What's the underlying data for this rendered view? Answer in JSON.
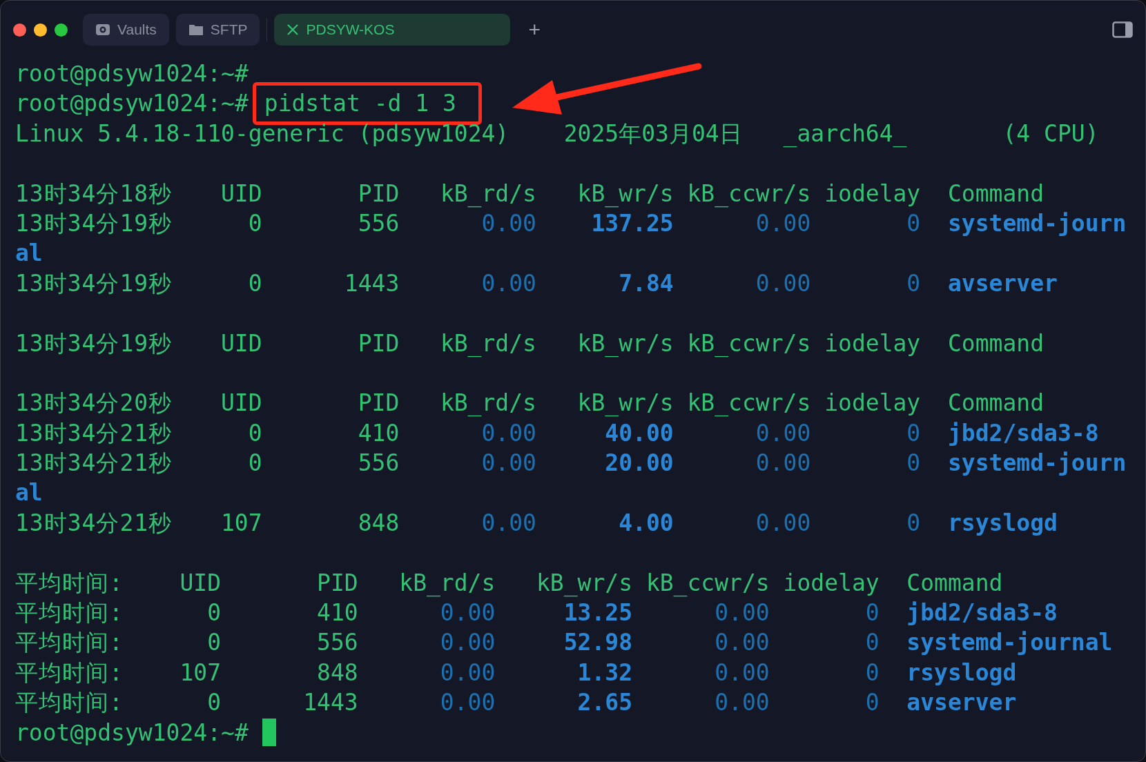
{
  "tabs": [
    {
      "label": "Vaults",
      "kind": "vault",
      "selected": false
    },
    {
      "label": "SFTP",
      "kind": "folder",
      "selected": false
    },
    {
      "label": "PDSYW-KOS",
      "kind": "session",
      "selected": true
    }
  ],
  "new_tab": "+",
  "lines": [
    {
      "kind": "prompt",
      "prompt": "root@pdsyw1024:~#",
      "highlighted": false,
      "cursor": false
    },
    {
      "kind": "prompt",
      "prompt": "root@pdsyw1024:~#",
      "command": "pidstat -d 1 3",
      "highlighted": true,
      "cursor": false
    },
    {
      "kind": "info",
      "fields": [
        "Linux 5.4.18-110-generic (pdsyw1024)",
        "2025年03月04日",
        "_aarch64_",
        "(4 CPU)"
      ]
    },
    {
      "kind": "blank"
    },
    {
      "kind": "header",
      "time": "13时34分18秒",
      "uid": "UID",
      "pid": "PID",
      "rd": "kB_rd/s",
      "wr": "kB_wr/s",
      "ccwr": "kB_ccwr/s",
      "iodelay": "iodelay",
      "command": "Command"
    },
    {
      "kind": "row",
      "time": "13时34分19秒",
      "uid": "0",
      "pid": "556",
      "rd": "0.00",
      "wr": "137.25",
      "ccwr": "0.00",
      "iodelay": "0",
      "command": "systemd-journ"
    },
    {
      "kind": "wrap",
      "text": "al"
    },
    {
      "kind": "row",
      "time": "13时34分19秒",
      "uid": "0",
      "pid": "1443",
      "rd": "0.00",
      "wr": "7.84",
      "ccwr": "0.00",
      "iodelay": "0",
      "command": "avserver"
    },
    {
      "kind": "blank"
    },
    {
      "kind": "header",
      "time": "13时34分19秒",
      "uid": "UID",
      "pid": "PID",
      "rd": "kB_rd/s",
      "wr": "kB_wr/s",
      "ccwr": "kB_ccwr/s",
      "iodelay": "iodelay",
      "command": "Command"
    },
    {
      "kind": "blank"
    },
    {
      "kind": "header",
      "time": "13时34分20秒",
      "uid": "UID",
      "pid": "PID",
      "rd": "kB_rd/s",
      "wr": "kB_wr/s",
      "ccwr": "kB_ccwr/s",
      "iodelay": "iodelay",
      "command": "Command"
    },
    {
      "kind": "row",
      "time": "13时34分21秒",
      "uid": "0",
      "pid": "410",
      "rd": "0.00",
      "wr": "40.00",
      "ccwr": "0.00",
      "iodelay": "0",
      "command": "jbd2/sda3-8"
    },
    {
      "kind": "row",
      "time": "13时34分21秒",
      "uid": "0",
      "pid": "556",
      "rd": "0.00",
      "wr": "20.00",
      "ccwr": "0.00",
      "iodelay": "0",
      "command": "systemd-journ"
    },
    {
      "kind": "wrap",
      "text": "al"
    },
    {
      "kind": "row",
      "time": "13时34分21秒",
      "uid": "107",
      "pid": "848",
      "rd": "0.00",
      "wr": "4.00",
      "ccwr": "0.00",
      "iodelay": "0",
      "command": "rsyslogd"
    },
    {
      "kind": "blank"
    },
    {
      "kind": "header",
      "time": "平均时间:",
      "uid": "UID",
      "pid": "PID",
      "rd": "kB_rd/s",
      "wr": "kB_wr/s",
      "ccwr": "kB_ccwr/s",
      "iodelay": "iodelay",
      "command": "Command"
    },
    {
      "kind": "row",
      "time": "平均时间:",
      "uid": "0",
      "pid": "410",
      "rd": "0.00",
      "wr": "13.25",
      "ccwr": "0.00",
      "iodelay": "0",
      "command": "jbd2/sda3-8"
    },
    {
      "kind": "row",
      "time": "平均时间:",
      "uid": "0",
      "pid": "556",
      "rd": "0.00",
      "wr": "52.98",
      "ccwr": "0.00",
      "iodelay": "0",
      "command": "systemd-journal"
    },
    {
      "kind": "row",
      "time": "平均时间:",
      "uid": "107",
      "pid": "848",
      "rd": "0.00",
      "wr": "1.32",
      "ccwr": "0.00",
      "iodelay": "0",
      "command": "rsyslogd"
    },
    {
      "kind": "row",
      "time": "平均时间:",
      "uid": "0",
      "pid": "1443",
      "rd": "0.00",
      "wr": "2.65",
      "ccwr": "0.00",
      "iodelay": "0",
      "command": "avserver"
    },
    {
      "kind": "prompt",
      "prompt": "root@pdsyw1024:~#",
      "highlighted": false,
      "cursor": true
    }
  ]
}
